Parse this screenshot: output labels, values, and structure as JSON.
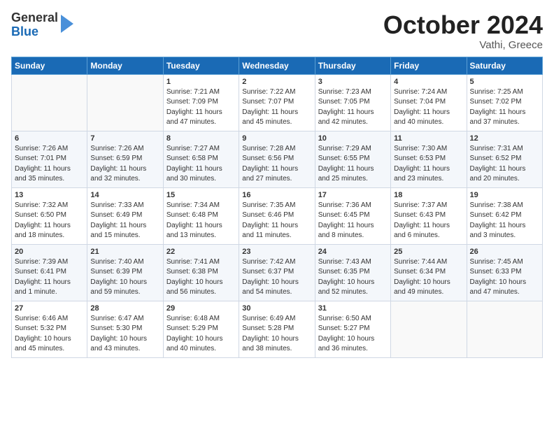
{
  "header": {
    "logo_general": "General",
    "logo_blue": "Blue",
    "month_title": "October 2024",
    "location": "Vathi, Greece"
  },
  "days_of_week": [
    "Sunday",
    "Monday",
    "Tuesday",
    "Wednesday",
    "Thursday",
    "Friday",
    "Saturday"
  ],
  "weeks": [
    [
      {
        "day": "",
        "info": ""
      },
      {
        "day": "",
        "info": ""
      },
      {
        "day": "1",
        "info": "Sunrise: 7:21 AM\nSunset: 7:09 PM\nDaylight: 11 hours\nand 47 minutes."
      },
      {
        "day": "2",
        "info": "Sunrise: 7:22 AM\nSunset: 7:07 PM\nDaylight: 11 hours\nand 45 minutes."
      },
      {
        "day": "3",
        "info": "Sunrise: 7:23 AM\nSunset: 7:05 PM\nDaylight: 11 hours\nand 42 minutes."
      },
      {
        "day": "4",
        "info": "Sunrise: 7:24 AM\nSunset: 7:04 PM\nDaylight: 11 hours\nand 40 minutes."
      },
      {
        "day": "5",
        "info": "Sunrise: 7:25 AM\nSunset: 7:02 PM\nDaylight: 11 hours\nand 37 minutes."
      }
    ],
    [
      {
        "day": "6",
        "info": "Sunrise: 7:26 AM\nSunset: 7:01 PM\nDaylight: 11 hours\nand 35 minutes."
      },
      {
        "day": "7",
        "info": "Sunrise: 7:26 AM\nSunset: 6:59 PM\nDaylight: 11 hours\nand 32 minutes."
      },
      {
        "day": "8",
        "info": "Sunrise: 7:27 AM\nSunset: 6:58 PM\nDaylight: 11 hours\nand 30 minutes."
      },
      {
        "day": "9",
        "info": "Sunrise: 7:28 AM\nSunset: 6:56 PM\nDaylight: 11 hours\nand 27 minutes."
      },
      {
        "day": "10",
        "info": "Sunrise: 7:29 AM\nSunset: 6:55 PM\nDaylight: 11 hours\nand 25 minutes."
      },
      {
        "day": "11",
        "info": "Sunrise: 7:30 AM\nSunset: 6:53 PM\nDaylight: 11 hours\nand 23 minutes."
      },
      {
        "day": "12",
        "info": "Sunrise: 7:31 AM\nSunset: 6:52 PM\nDaylight: 11 hours\nand 20 minutes."
      }
    ],
    [
      {
        "day": "13",
        "info": "Sunrise: 7:32 AM\nSunset: 6:50 PM\nDaylight: 11 hours\nand 18 minutes."
      },
      {
        "day": "14",
        "info": "Sunrise: 7:33 AM\nSunset: 6:49 PM\nDaylight: 11 hours\nand 15 minutes."
      },
      {
        "day": "15",
        "info": "Sunrise: 7:34 AM\nSunset: 6:48 PM\nDaylight: 11 hours\nand 13 minutes."
      },
      {
        "day": "16",
        "info": "Sunrise: 7:35 AM\nSunset: 6:46 PM\nDaylight: 11 hours\nand 11 minutes."
      },
      {
        "day": "17",
        "info": "Sunrise: 7:36 AM\nSunset: 6:45 PM\nDaylight: 11 hours\nand 8 minutes."
      },
      {
        "day": "18",
        "info": "Sunrise: 7:37 AM\nSunset: 6:43 PM\nDaylight: 11 hours\nand 6 minutes."
      },
      {
        "day": "19",
        "info": "Sunrise: 7:38 AM\nSunset: 6:42 PM\nDaylight: 11 hours\nand 3 minutes."
      }
    ],
    [
      {
        "day": "20",
        "info": "Sunrise: 7:39 AM\nSunset: 6:41 PM\nDaylight: 11 hours\nand 1 minute."
      },
      {
        "day": "21",
        "info": "Sunrise: 7:40 AM\nSunset: 6:39 PM\nDaylight: 10 hours\nand 59 minutes."
      },
      {
        "day": "22",
        "info": "Sunrise: 7:41 AM\nSunset: 6:38 PM\nDaylight: 10 hours\nand 56 minutes."
      },
      {
        "day": "23",
        "info": "Sunrise: 7:42 AM\nSunset: 6:37 PM\nDaylight: 10 hours\nand 54 minutes."
      },
      {
        "day": "24",
        "info": "Sunrise: 7:43 AM\nSunset: 6:35 PM\nDaylight: 10 hours\nand 52 minutes."
      },
      {
        "day": "25",
        "info": "Sunrise: 7:44 AM\nSunset: 6:34 PM\nDaylight: 10 hours\nand 49 minutes."
      },
      {
        "day": "26",
        "info": "Sunrise: 7:45 AM\nSunset: 6:33 PM\nDaylight: 10 hours\nand 47 minutes."
      }
    ],
    [
      {
        "day": "27",
        "info": "Sunrise: 6:46 AM\nSunset: 5:32 PM\nDaylight: 10 hours\nand 45 minutes."
      },
      {
        "day": "28",
        "info": "Sunrise: 6:47 AM\nSunset: 5:30 PM\nDaylight: 10 hours\nand 43 minutes."
      },
      {
        "day": "29",
        "info": "Sunrise: 6:48 AM\nSunset: 5:29 PM\nDaylight: 10 hours\nand 40 minutes."
      },
      {
        "day": "30",
        "info": "Sunrise: 6:49 AM\nSunset: 5:28 PM\nDaylight: 10 hours\nand 38 minutes."
      },
      {
        "day": "31",
        "info": "Sunrise: 6:50 AM\nSunset: 5:27 PM\nDaylight: 10 hours\nand 36 minutes."
      },
      {
        "day": "",
        "info": ""
      },
      {
        "day": "",
        "info": ""
      }
    ]
  ]
}
